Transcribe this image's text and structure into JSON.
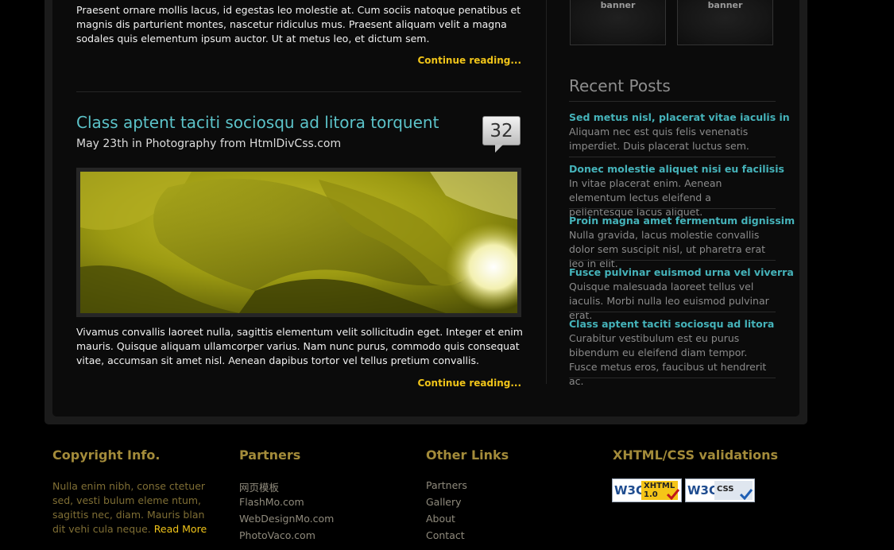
{
  "post1": {
    "excerpt": "Praesent ornare mollis lacus, id egestas leo molestie at. Cum sociis natoque penatibus et magnis dis parturient montes, nascetur ridiculus mus. Praesent aliquam velit a magna sodales quis elementum ipsum auctor. Ut at metus leo, et dictum sem.",
    "continue_label": "Continue reading..."
  },
  "post2": {
    "title": "Class aptent taciti sociosqu ad litora torquent",
    "meta": "May 23th in Photography from HtmlDivCss.com",
    "comment_count": "32",
    "excerpt": "Vivamus convallis laoreet nulla, sagittis elementum velit sollicitudin eget. Integer et enim mauris. Quisque aliquam ullamcorper varius. Nam nunc purus, commodo quis consequat vitae, accumsan sit amet nisl. Aenean dapibus tortor vel tellus pretium convallis.",
    "continue_label": "Continue reading..."
  },
  "banners": [
    "banner",
    "banner"
  ],
  "recent_posts": {
    "heading": "Recent Posts",
    "items": [
      {
        "title": "Sed metus nisl, placerat vitae iaculis in",
        "text": "Aliquam nec est quis felis venenatis imperdiet. Duis placerat luctus sem."
      },
      {
        "title": "Donec molestie aliquet nisi eu facilisis",
        "text": "In vitae placerat enim. Aenean elementum lectus eleifend a pellentesque lacus aliquet."
      },
      {
        "title": "Proin magna amet fermentum dignissim",
        "text": "Nulla gravida, lacus molestie convallis dolor sem suscipit nisl, ut pharetra erat leo in elit."
      },
      {
        "title": "Fusce pulvinar euismod urna vel viverra",
        "text": "Quisque malesuada laoreet tellus vel iaculis. Morbi nulla leo euismod pulvinar erat."
      },
      {
        "title": "Class aptent taciti sociosqu ad litora",
        "text": "Curabitur vestibulum est eu purus bibendum eu eleifend diam tempor. Fusce metus eros, faucibus ut hendrerit ac."
      }
    ]
  },
  "footer": {
    "copyright": {
      "heading": "Copyright Info.",
      "text": "Nulla enim nibh, conse ctetuer sed, vesti bulum eleme ntum, sagittis nec, diam. Mauris blan dit vehi cula neque.",
      "read_more": "Read More"
    },
    "partners": {
      "heading": "Partners",
      "links": [
        "网页模板",
        "FlashMo.com",
        "WebDesignMo.com",
        "PhotoVaco.com"
      ]
    },
    "other_links": {
      "heading": "Other Links",
      "links": [
        "Partners",
        "Gallery",
        "About",
        "Contact"
      ]
    },
    "validations": {
      "heading": "XHTML/CSS validations",
      "badges": [
        {
          "logo": "W3C",
          "label": "XHTML",
          "version": "1.0"
        },
        {
          "logo": "W3C",
          "label": "CSS"
        }
      ]
    }
  },
  "colors": {
    "accent_teal": "#5cc3c9",
    "link_yellow": "#f0c419",
    "footer_heading": "#a38b3a"
  }
}
